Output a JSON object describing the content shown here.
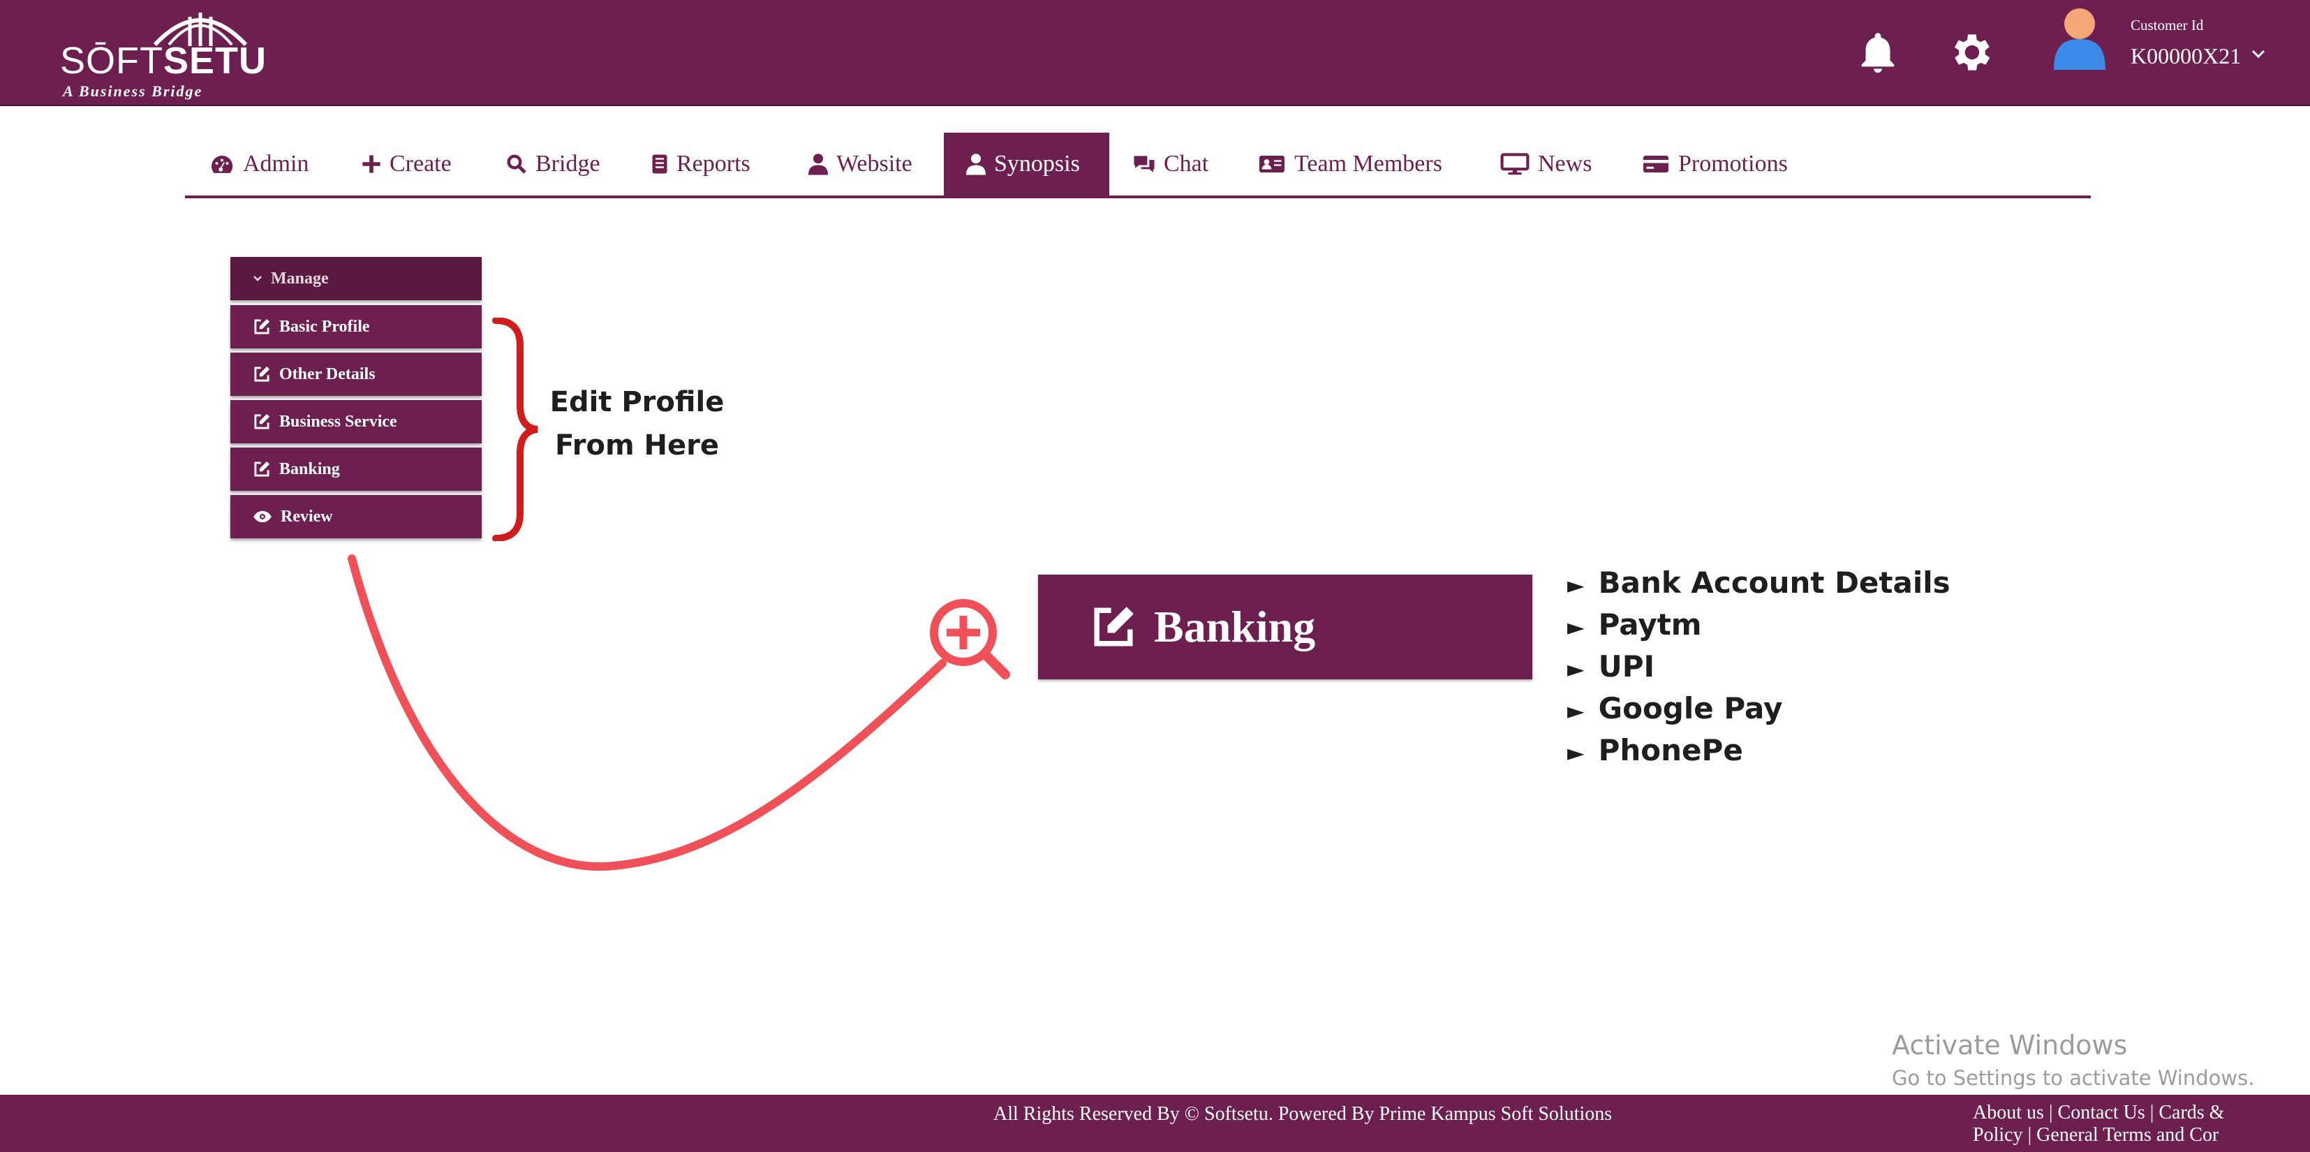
{
  "header": {
    "logo_text_light": "SŌFT",
    "logo_text_bold": "SETU",
    "logo_tagline": "A Business Bridge",
    "customer_label": "Customer Id",
    "customer_id": "K00000X21"
  },
  "nav": {
    "tabs": [
      {
        "label": "Admin",
        "icon": "dashboard-icon"
      },
      {
        "label": "Create",
        "icon": "plus-icon"
      },
      {
        "label": "Bridge",
        "icon": "search-icon"
      },
      {
        "label": "Reports",
        "icon": "report-icon"
      },
      {
        "label": "Website",
        "icon": "user-icon"
      },
      {
        "label": "Synopsis",
        "icon": "user-icon",
        "active": true
      },
      {
        "label": "Chat",
        "icon": "chat-icon"
      },
      {
        "label": "Team Members",
        "icon": "id-card-icon"
      },
      {
        "label": "News",
        "icon": "monitor-icon"
      },
      {
        "label": "Promotions",
        "icon": "credit-card-icon"
      }
    ]
  },
  "menu": {
    "header": "Manage",
    "items": [
      {
        "label": "Basic Profile",
        "icon": "edit-icon"
      },
      {
        "label": "Other Details",
        "icon": "edit-icon"
      },
      {
        "label": "Business Service",
        "icon": "edit-icon"
      },
      {
        "label": "Banking",
        "icon": "edit-icon"
      },
      {
        "label": "Review",
        "icon": "eye-icon"
      }
    ]
  },
  "annotation": {
    "line1": "Edit Profile",
    "line2": "From Here"
  },
  "zoom": {
    "label": "Banking",
    "items": [
      "Bank Account Details",
      "Paytm",
      "UPI",
      "Google Pay",
      "PhonePe"
    ],
    "marker": "►"
  },
  "watermark": {
    "title": "Activate Windows",
    "subtitle": "Go to Settings to activate Windows."
  },
  "footer": {
    "copyright": "All Rights Reserved By © Softsetu. Powered By Prime Kampus Soft Solutions",
    "about": "About us",
    "contact": "Contact Us",
    "cards": "Cards &",
    "policy": "Policy",
    "terms": "General Terms and Cor",
    "sep": "|"
  },
  "colors": {
    "brand": "#6d1f4f",
    "annotation_red": "#f05058",
    "brace_red": "#d01c1c"
  }
}
